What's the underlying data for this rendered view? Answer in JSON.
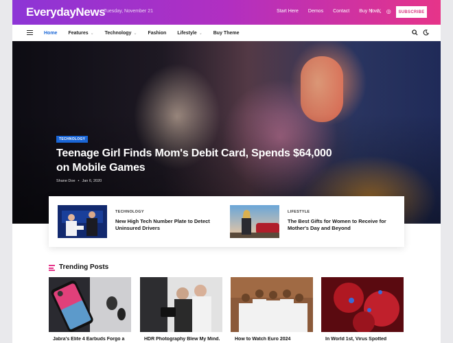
{
  "topbar": {
    "logo": "EverydayNews",
    "date": "Tuesday, November 21",
    "links": [
      "Start Here",
      "Demos",
      "Contact",
      "Buy Now"
    ],
    "social": [
      "f",
      "𝕏",
      "◎"
    ],
    "subscribe_label": "SUBSCRIBE"
  },
  "nav": {
    "items": [
      {
        "label": "Home",
        "active": true,
        "dropdown": false
      },
      {
        "label": "Features",
        "active": false,
        "dropdown": true
      },
      {
        "label": "Technology",
        "active": false,
        "dropdown": true
      },
      {
        "label": "Fashion",
        "active": false,
        "dropdown": false
      },
      {
        "label": "Lifestyle",
        "active": false,
        "dropdown": true
      },
      {
        "label": "Buy Theme",
        "active": false,
        "dropdown": false
      }
    ],
    "icons": [
      "search-icon",
      "dark-mode-icon"
    ]
  },
  "hero": {
    "category": "TECHNOLOGY",
    "title": "Teenage Girl Finds Mom's Debit Card, Spends $64,000 on Mobile Games",
    "author": "Shane Doe",
    "separator": "•",
    "date": "Jan 6, 2020"
  },
  "featured": [
    {
      "category": "TECHNOLOGY",
      "title": "New High Tech Number Plate to Detect Uninsured Drivers"
    },
    {
      "category": "LIFESTYLE",
      "title": "The Best Gifts for Women to Receive for Mother's Day and Beyond"
    }
  ],
  "trending": {
    "heading": "Trending Posts",
    "posts": [
      {
        "title": "Jabra's Elite 4 Earbuds Forgo a"
      },
      {
        "title": "HDR Photography Blew My Mind."
      },
      {
        "title": "How to Watch Euro 2024"
      },
      {
        "title": "In World 1st, Virus Spotted"
      }
    ]
  },
  "colors": {
    "accent": "#1a66d6",
    "brand_gradient_start": "#8d35d6",
    "brand_gradient_end": "#e63489"
  }
}
